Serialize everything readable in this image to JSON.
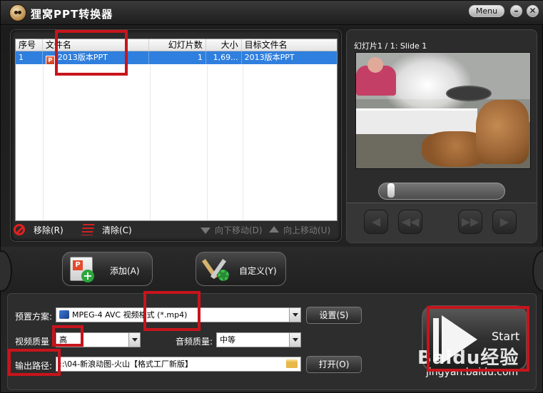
{
  "app": {
    "title": "狸窝PPT转换器",
    "menu_label": "Menu",
    "minimize_symbol": "–",
    "close_symbol": "✕",
    "logo_icon": "raccoon-logo-icon"
  },
  "file_list": {
    "columns": [
      "序号",
      "文件名",
      "幻灯片数",
      "大小",
      "目标文件名"
    ],
    "rows": [
      {
        "index": "1",
        "file_name": "2013版本PPT",
        "slides": "1",
        "size": "1,69...",
        "target_name": "2013版本PPT",
        "icon": "ppt-file-icon"
      }
    ],
    "selected_row_color": "#2f7fde"
  },
  "list_actions": {
    "remove": "移除(R)",
    "clear": "清除(C)",
    "move_down": "向下移动(D)",
    "move_up": "向上移动(U)"
  },
  "preview": {
    "label": "幻灯片1 / 1: Slide 1",
    "controls": [
      "first-icon",
      "rewind-icon",
      "forward-icon",
      "last-icon"
    ],
    "control_glyphs": [
      "◀",
      "◀◀",
      "▶▶",
      "▶"
    ],
    "slider_progress": 0.0
  },
  "buttons": {
    "add": "添加(A)",
    "customize": "自定义(Y)"
  },
  "settings": {
    "preset_label": "预置方案:",
    "preset_value": "MPEG-4 AVC 视频格式 (*.mp4)",
    "settings_button": "设置(S)",
    "video_quality_label": "视频质量",
    "video_quality_value": "高",
    "audio_quality_label": "音频质量:",
    "audio_quality_value": "中等",
    "output_path_label": "输出路径:",
    "output_path_value": "::\\04-新浪动图-火山【格式工厂新版】",
    "open_button": "打开(O)"
  },
  "start": {
    "label": "Start"
  },
  "watermark": {
    "text": "Baidu经验",
    "url": "jingyan.baidu.com"
  },
  "colors": {
    "highlight_box": "#c8141c",
    "window_bg": "#262626",
    "selection": "#2f7fde"
  }
}
